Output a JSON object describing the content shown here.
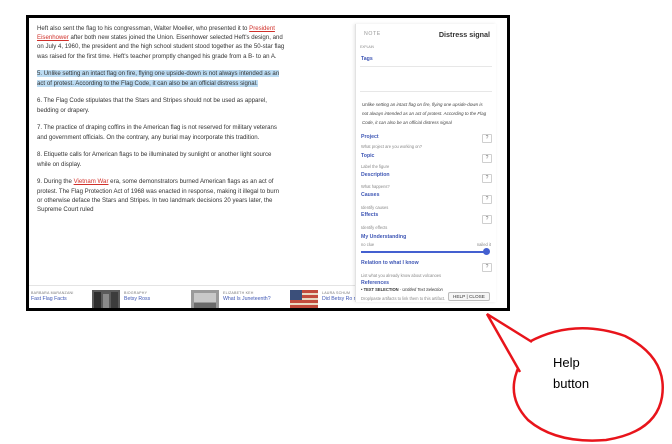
{
  "article": {
    "p1_a": "Heft also sent the flag to his congressman, Walter Moeller, who presented it to ",
    "p1_link": "President Eisenhower",
    "p1_b": " after both new states joined the Union. Eisenhower selected Heft's design, and on July 4, 1960, the president and the high school student stood together as the 50-star flag was raised for the first time. Heft's teacher promptly changed his grade from a B- to an A.",
    "p5": "5. Unlike setting an intact flag on fire, flying one upside-down is not always intended as an act of protest. According to the Flag Code, it can also be an official distress signal.",
    "p6": "6. The Flag Code stipulates that the Stars and Stripes should not be used as apparel, bedding or drapery.",
    "p7": "7. The practice of draping coffins in the American flag is not reserved for military veterans and government officials. On the contrary, any burial may incorporate this tradition.",
    "p8": "8. Etiquette calls for American flags to be illuminated by sunlight or another light source while on display.",
    "p9_a": "9. During the ",
    "p9_link": "Vietnam War",
    "p9_b": " era, some demonstrators burned American flags as an act of protest. The Flag Protection Act of 1968 was enacted in response, making it illegal to burn or otherwise deface the Stars and Stripes. In two landmark decisions 20 years later, the Supreme Court ruled"
  },
  "strip": [
    {
      "author": "BARBARA MARANZANI",
      "title": "Fast Flag Facts"
    },
    {
      "author": "BIOGRAPHY",
      "title": "Betsy Ross"
    },
    {
      "author": "ELIZABETH KEH",
      "title": "What Is Juneteenth?"
    },
    {
      "author": "LAURA SCHUM",
      "title": "Did Betsy Ro really make t"
    }
  ],
  "panel": {
    "note_label": "NOTE",
    "title": "Distress signal",
    "explain": "EXPLAIN",
    "tags_label": "Tags",
    "quote": "Unlike setting an intact flag on fire, flying one upside-down is not always intended as an act of protest. According to the Flag Code, it can also be an official distress signal",
    "project_label": "Project",
    "project_sub": "What project are you working on?",
    "topic_label": "Topic",
    "topic_sub": "Label the figure",
    "description_label": "Description",
    "description_sub": "What happens?",
    "causes_label": "Causes",
    "causes_sub": "Identify causes",
    "effects_label": "Effects",
    "effects_sub": "Identify effects",
    "understanding_label": "My Understanding",
    "understanding_min": "no clue",
    "understanding_max": "nailed it",
    "understanding_value": 1.0,
    "relation_label": "Relation to what I know",
    "relation_sub": "List what you already know about volcanoes",
    "references_label": "References",
    "ref_item_bold": "TEXT SELECTION",
    "ref_item_rest": " - Untitled Text Selection",
    "drop_hint": "Drop/paste artifacts to link them to this artifact.",
    "help_label": "HELP",
    "close_label": "CLOSE",
    "q": "?"
  },
  "callout": {
    "line1": "Help",
    "line2": "button",
    "color": "#e8141b"
  },
  "colors": {
    "link": "#d0302a",
    "highlight": "#bcdcf3",
    "accent": "#3f57b5"
  }
}
